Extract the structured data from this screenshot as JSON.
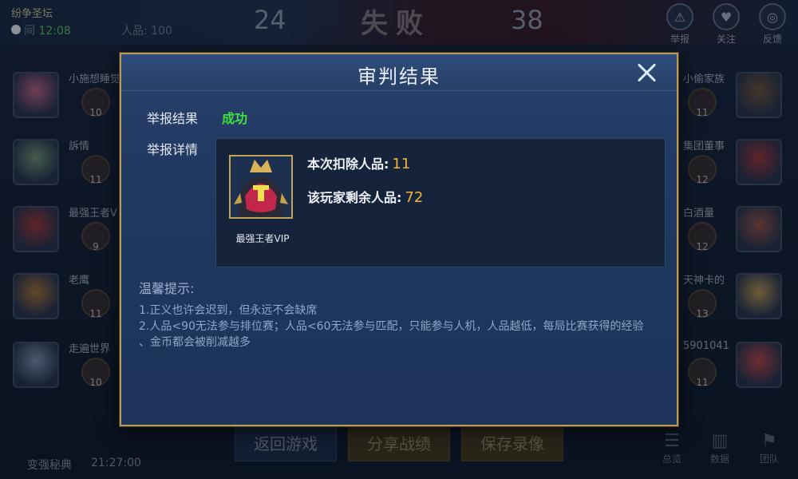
{
  "background": {
    "top_left_title": "纷争圣坛",
    "time_label": "间",
    "time_value": "12:08",
    "renpin_label": "人品: 100",
    "score_left": "24",
    "score_right": "38",
    "result_text": "失败",
    "top_actions": [
      {
        "label": "举报",
        "icon": "warning-icon"
      },
      {
        "label": "关注",
        "icon": "heart-icon"
      },
      {
        "label": "反馈",
        "icon": "headset-icon"
      }
    ],
    "left_players": [
      {
        "name": "小施想睡觉",
        "kda": "10",
        "color": "#c86a8c"
      },
      {
        "name": "訴情",
        "kda": "11",
        "color": "#7aa07a"
      },
      {
        "name": "最强王者V",
        "kda": "9",
        "color": "#a83a3a"
      },
      {
        "name": "老鹰",
        "kda": "11",
        "color": "#b27a3a"
      },
      {
        "name": "走遍世界",
        "kda": "10",
        "color": "#8a9ab8"
      }
    ],
    "right_players": [
      {
        "name": "小偷家族",
        "kda": "11",
        "color": "#7a5a3a"
      },
      {
        "name": "集团董事",
        "kda": "12",
        "color": "#a83a3a"
      },
      {
        "name": "白酒量",
        "kda": "12",
        "color": "#a05a4a"
      },
      {
        "name": "天神卡的",
        "kda": "13",
        "color": "#c8a05a"
      },
      {
        "name": "5901041",
        "kda": "11",
        "color": "#c84a4a"
      }
    ],
    "bottom_buttons": [
      "返回游戏",
      "分享战绩",
      "保存录像"
    ],
    "bottom_left": {
      "label1": "变强秘典",
      "label2": "21:27:00"
    },
    "bottom_tabs": [
      {
        "label": "总览",
        "icon": "list-icon"
      },
      {
        "label": "数据",
        "icon": "bar-chart-icon"
      },
      {
        "label": "团队",
        "icon": "flag-icon"
      }
    ]
  },
  "modal": {
    "title": "审判结果",
    "result_label": "举报结果",
    "result_value": "成功",
    "detail_label": "举报详情",
    "hero_name": "最强王者VIP",
    "deduct_label": "本次扣除人品:",
    "deduct_value": "11",
    "remain_label": "该玩家剩余人品:",
    "remain_value": "72",
    "tips_title": "温馨提示:",
    "tips": [
      "1.正义也许会迟到，但永远不会缺席",
      "2.人品<90无法参与排位赛；人品<60无法参与匹配，只能参与人机，人品越低，每局比赛获得的经验",
      "、金币都会被削减越多"
    ]
  },
  "colors": {
    "success": "#3fe03f",
    "number_highlight": "#f4b43a",
    "modal_border": "#b79b5c"
  }
}
